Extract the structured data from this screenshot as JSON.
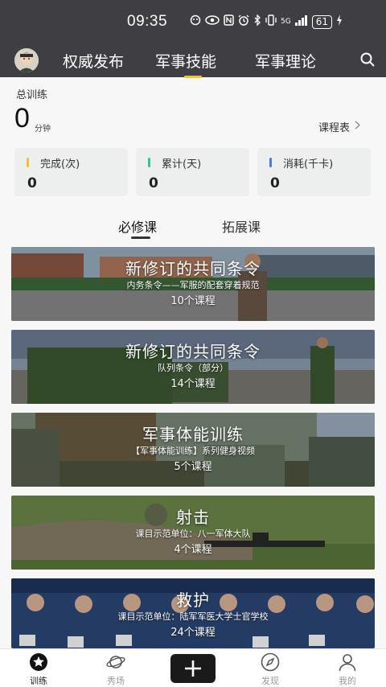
{
  "status_bar": {
    "time": "09:35",
    "icons": [
      "wechat-icon",
      "eye-icon",
      "nfc-icon",
      "alarm-icon",
      "bluetooth-icon",
      "vibrate-icon",
      "signal-5g-icon",
      "signal-icon"
    ],
    "net_label": "5G",
    "battery": "61"
  },
  "top_nav": {
    "tabs": [
      {
        "label": "权威发布",
        "active": false
      },
      {
        "label": "军事技能",
        "active": true
      },
      {
        "label": "军事理论",
        "active": false
      }
    ]
  },
  "summary": {
    "label": "总训练",
    "total_value": "0",
    "total_unit": "分钟",
    "schedule_link": "课程表"
  },
  "stats": [
    {
      "label": "完成(次)",
      "value": "0",
      "color": "#f2c037"
    },
    {
      "label": "累计(天)",
      "value": "0",
      "color": "#3fbf8f"
    },
    {
      "label": "消耗(千卡)",
      "value": "0",
      "color": "#4a7bd8"
    }
  ],
  "segment_tabs": [
    {
      "label": "必修课",
      "active": true
    },
    {
      "label": "拓展课",
      "active": false
    }
  ],
  "courses": [
    {
      "title": "新修订的共同条令",
      "subtitle": "内务条令——军服的配套穿着规范",
      "count": "10个课程"
    },
    {
      "title": "新修订的共同条令",
      "subtitle": "队列条令（部分）",
      "count": "14个课程"
    },
    {
      "title": "军事体能训练",
      "subtitle": "【军事体能训练】系列健身视频",
      "count": "5个课程"
    },
    {
      "title": "射击",
      "subtitle": "课目示范单位：八一军体大队",
      "count": "4个课程"
    },
    {
      "title": "救护",
      "subtitle": "课目示范单位：陆军军医大学士官学校",
      "count": "24个课程"
    }
  ],
  "bottom_nav": [
    {
      "label": "训练",
      "icon": "star-circle-icon",
      "active": true
    },
    {
      "label": "秀场",
      "icon": "planet-icon",
      "active": false
    },
    {
      "label": "",
      "icon": "plus-icon",
      "active": false
    },
    {
      "label": "发现",
      "icon": "compass-icon",
      "active": false
    },
    {
      "label": "我的",
      "icon": "person-icon",
      "active": false
    }
  ]
}
